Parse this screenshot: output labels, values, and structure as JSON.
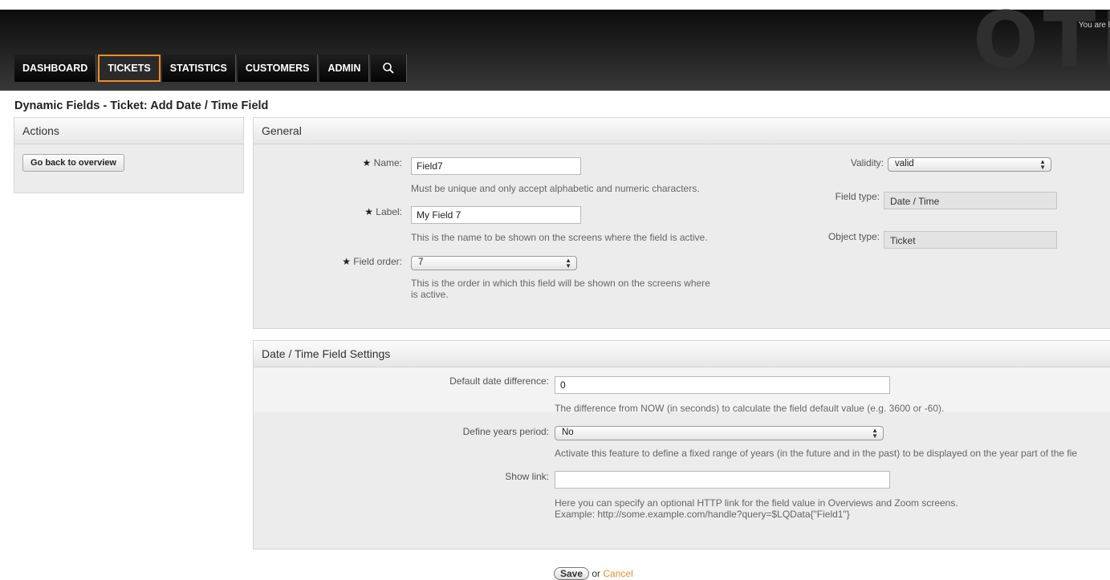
{
  "header": {
    "logo": "OTI",
    "login_text": "You are l",
    "nav": [
      "DASHBOARD",
      "TICKETS",
      "STATISTICS",
      "CUSTOMERS",
      "ADMIN"
    ],
    "selected_nav": "TICKETS",
    "accent_color": "#f28b23"
  },
  "page_title": "Dynamic Fields - Ticket: Add Date / Time Field",
  "sidebar": {
    "title": "Actions",
    "back_button": "Go back to overview"
  },
  "general": {
    "title": "General",
    "name_label": "Name:",
    "name_value": "Field7",
    "name_hint": "Must be unique and only accept alphabetic and numeric characters.",
    "label_label": "Label:",
    "label_value": "My Field 7",
    "label_hint": "This is the name to be shown on the screens where the field is active.",
    "order_label": "Field order:",
    "order_value": "7",
    "order_hint_1": "This is the order in which this field will be shown on the screens where",
    "order_hint_2": "is active.",
    "validity_label": "Validity:",
    "validity_value": "valid",
    "fieldtype_label": "Field type:",
    "fieldtype_value": "Date / Time",
    "objecttype_label": "Object type:",
    "objecttype_value": "Ticket"
  },
  "datetime": {
    "title": "Date / Time Field Settings",
    "default_diff_label": "Default date difference:",
    "default_diff_value": "0",
    "default_diff_hint": "The difference from NOW (in seconds) to calculate the field default value (e.g. 3600 or -60).",
    "years_label": "Define years period:",
    "years_value": "No",
    "years_hint": "Activate this feature to define a fixed range of years (in the future and in the past) to be displayed on the year part of the fie",
    "link_label": "Show link:",
    "link_value": "",
    "link_hint_1": "Here you can specify an optional HTTP link for the field value in Overviews and Zoom screens.",
    "link_hint_2": "Example: http://some.example.com/handle?query=$LQData{\"Field1\"}"
  },
  "footer": {
    "save": "Save",
    "or": "or",
    "cancel": "Cancel"
  }
}
